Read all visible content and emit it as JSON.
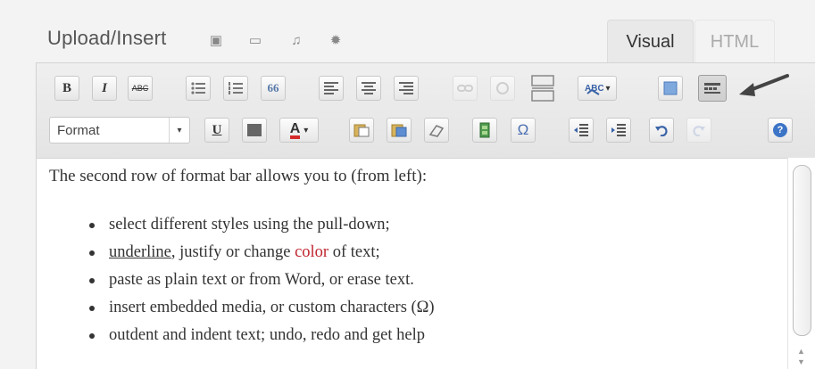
{
  "upload": {
    "label": "Upload/Insert",
    "icons": [
      "image-icon",
      "video-icon",
      "audio-icon",
      "media-icon"
    ]
  },
  "tabs": {
    "visual": "Visual",
    "html": "HTML",
    "active": "Visual"
  },
  "toolbar": {
    "row1": {
      "bold": "B",
      "italic": "I",
      "strikethrough": "ABC",
      "bullet_list": "☷",
      "numbered_list": "☷",
      "blockquote": "66",
      "spellcheck_arrow": "▾"
    },
    "row2": {
      "format": "Format",
      "format_arrow": "▾",
      "underline": "U",
      "text_color": "A",
      "text_color_arrow": "▾",
      "omega": "Ω",
      "help": "?"
    },
    "accent_red": "#d42b2b"
  },
  "content": {
    "intro": "The second row of format bar allows you to (from left):",
    "items": [
      {
        "parts": [
          {
            "text": "select different styles using the pull-down;"
          }
        ]
      },
      {
        "parts": [
          {
            "text": "underline",
            "style": "underline"
          },
          {
            "text": ", justify or change "
          },
          {
            "text": "color",
            "style": "red"
          },
          {
            "text": " of text;"
          }
        ]
      },
      {
        "parts": [
          {
            "text": "paste as plain text or from Word, or erase text."
          }
        ]
      },
      {
        "parts": [
          {
            "text": "insert embedded media, or custom characters (Ω)"
          }
        ]
      },
      {
        "parts": [
          {
            "text": "outdent and indent text; undo, redo and get help"
          }
        ]
      }
    ]
  },
  "annotation": {
    "type": "pointer-arrow",
    "points_to": "kitchen-sink-toggle-button"
  }
}
